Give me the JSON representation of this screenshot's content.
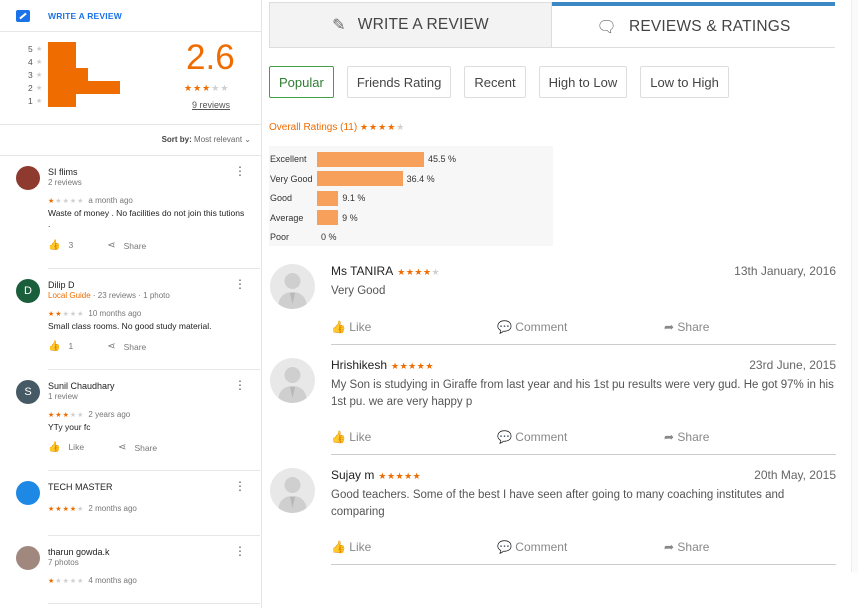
{
  "left": {
    "write_review": "WRITE A REVIEW",
    "histogram": [
      {
        "stars": "5",
        "fraction": 0.39
      },
      {
        "stars": "4",
        "fraction": 0.39
      },
      {
        "stars": "3",
        "fraction": 0.55
      },
      {
        "stars": "2",
        "fraction": 1.0
      },
      {
        "stars": "1",
        "fraction": 0.39
      }
    ],
    "score": "2.6",
    "score_stars": 2.6,
    "review_count": "9 reviews",
    "sort_label": "Sort by:",
    "sort_value": "Most relevant",
    "reviews": [
      {
        "avatar": "",
        "avatar_color": "#8e3a2f",
        "name": "SI flims",
        "sub": "2 reviews",
        "local_guide": "",
        "stars": 1,
        "time": "a month ago",
        "text": "Waste of money . No facilities do not join this tutions",
        "text2": ".",
        "likes": "3",
        "share": "Share"
      },
      {
        "avatar": "D",
        "avatar_color": "#1b5e3b",
        "name": "Dilip D",
        "sub": "· 23 reviews · 1 photo",
        "local_guide": "Local Guide",
        "stars": 2,
        "time": "10 months ago",
        "text": "Small class rooms. No good study material.",
        "text2": "",
        "likes": "1",
        "share": "Share"
      },
      {
        "avatar": "S",
        "avatar_color": "#455a64",
        "name": "Sunil Chaudhary",
        "sub": "1 review",
        "local_guide": "",
        "stars": 3,
        "time": "2 years ago",
        "text": "YTy your fc",
        "text2": "",
        "likes": "Like",
        "share": "Share"
      },
      {
        "avatar": "",
        "avatar_color": "#1e88e5",
        "name": "TECH MASTER",
        "sub": "",
        "local_guide": "",
        "stars": 4,
        "time": "2 months ago",
        "text": "",
        "text2": "",
        "likes": "",
        "share": ""
      },
      {
        "avatar": "",
        "avatar_color": "#a1887f",
        "name": "tharun gowda.k",
        "sub": "7 photos",
        "local_guide": "",
        "stars": 1,
        "time": "4 months ago",
        "text": "",
        "text2": "",
        "likes": "",
        "share": ""
      }
    ]
  },
  "right": {
    "tabs": [
      {
        "label": "WRITE A REVIEW",
        "icon": "pencil-icon"
      },
      {
        "label": "REVIEWS & RATINGS",
        "icon": "comment-icon"
      }
    ],
    "filters": [
      "Popular",
      "Friends Rating",
      "Recent",
      "High to Low",
      "Low to High"
    ],
    "active_filter": "Popular",
    "overall": "Overall Ratings (11)",
    "overall_stars": 4,
    "distribution": [
      {
        "label": "Excellent",
        "percent": 45.5,
        "text": "45.5 %"
      },
      {
        "label": "Very Good",
        "percent": 36.4,
        "text": "36.4 %"
      },
      {
        "label": "Good",
        "percent": 9.1,
        "text": "9.1 %"
      },
      {
        "label": "Average",
        "percent": 9,
        "text": "9 %"
      },
      {
        "label": "Poor",
        "percent": 0,
        "text": "0 %"
      }
    ],
    "posts": [
      {
        "name": "Ms TANIRA",
        "stars": 4,
        "date": "13th January, 2016",
        "text": "Very Good"
      },
      {
        "name": "Hrishikesh",
        "stars": 5,
        "date": "23rd June, 2015",
        "text": "My Son is studying in Giraffe from last year and his 1st pu results were very gud. He got 97% in his 1st pu. we are very happy p"
      },
      {
        "name": "Sujay m",
        "stars": 5,
        "date": "20th May, 2015",
        "text": "Good teachers. Some of the best I have seen after going to many coaching institutes and comparing"
      }
    ],
    "actions": {
      "like": "Like",
      "comment": "Comment",
      "share": "Share"
    }
  },
  "colors": {
    "accent": "#ef6c00",
    "tab_active": "#3b88c4",
    "link": "#1a73e8",
    "filter_active": "#43a047"
  }
}
